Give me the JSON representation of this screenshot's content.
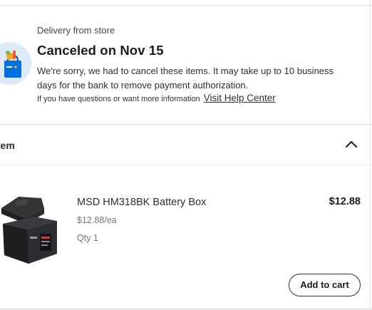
{
  "status": {
    "delivery_label": "Delivery from store",
    "title": "Canceled on Nov 15",
    "message": "We're sorry, we had to cancel these items. It may take up to 10 business days for the bank to remove payment authorization.",
    "help_prefix": "If you have questions or want more information",
    "help_link": "Visit Help Center",
    "icon": "walmart-bag-icon"
  },
  "items_section": {
    "header_label": "item",
    "chevron_icon": "chevron-up-icon"
  },
  "product": {
    "name": "MSD HM318BK Battery Box",
    "unit_price": "$12.88/ea",
    "quantity": "Qty 1",
    "price": "$12.88",
    "image": "battery-box-image",
    "add_to_cart_label": "Add to cart"
  },
  "colors": {
    "brand_blue": "#0071dc",
    "icon_bg": "#dcebf7",
    "text_primary": "#2e2f32",
    "text_secondary": "#74767c"
  }
}
